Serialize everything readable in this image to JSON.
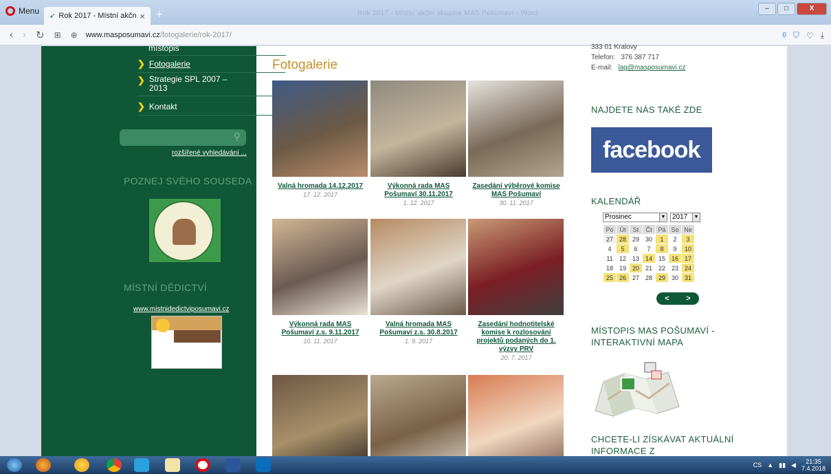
{
  "browser": {
    "menu_label": "Menu",
    "tab_title": "Rok 2017 - Místní akční sk",
    "tab_close": "×",
    "new_tab": "+",
    "window_title": "Rok 2017 - Místní akční skupina MAS Pošumaví - Word",
    "url_host": "www.masposumavi.cz",
    "url_path": "/fotogalerie/rok-2017/",
    "addr_right_count": "0"
  },
  "sidebar": {
    "top_item": "místopis",
    "items": [
      {
        "label": "Fotogalerie",
        "active": true
      },
      {
        "label": "Strategie SPL 2007 – 2013",
        "active": false
      },
      {
        "label": "Kontakt",
        "active": false
      }
    ],
    "advanced_search": "rozšířené vyhledávání ...",
    "neighbor_heading": "POZNEJ SVÉHO SOUSEDA",
    "heritage_heading": "MÍSTNÍ DĚDICTVÍ",
    "heritage_link": "www.mistnidedictviposumavi.cz"
  },
  "main": {
    "title": "Fotogalerie",
    "gallery": [
      {
        "title": "Valná hromada 14.12.2017",
        "date": "17. 12. 2017",
        "colors": [
          "#3e5a86",
          "#6d5a45",
          "#b98d6e"
        ]
      },
      {
        "title": "Výkonná rada MAS Pošumaví 30.11.2017",
        "date": "1. 12. 2017",
        "colors": [
          "#8f8a7e",
          "#c4b49b",
          "#4b3b2e"
        ]
      },
      {
        "title": "Zasedání výběrové komise MAS Pošumaví",
        "date": "30. 11. 2017",
        "colors": [
          "#e4e3df",
          "#7a6a57",
          "#b2a48e"
        ]
      },
      {
        "title": "Výkonná rada MAS Pošumaví z.s. 9.11.2017",
        "date": "10. 11. 2017",
        "colors": [
          "#d2b694",
          "#6d5b52",
          "#e9e2d6"
        ]
      },
      {
        "title": "Valná hromada MAS Pošumaví z.s. 30.8.2017",
        "date": "1. 9. 2017",
        "colors": [
          "#b68a63",
          "#e0d6c6",
          "#6b5b4b"
        ]
      },
      {
        "title": "Zasedání hodnotitelské komise k rozlosování projektů podaných do 1. výzvy PRV",
        "date": "20. 7. 2017",
        "colors": [
          "#c89a76",
          "#7b1e24",
          "#3f3f3f"
        ]
      },
      {
        "title": "",
        "date": "",
        "colors": [
          "#6e5845",
          "#a88f6a",
          "#2f261f"
        ]
      },
      {
        "title": "",
        "date": "",
        "colors": [
          "#b9a88f",
          "#7a6148",
          "#d8cfc2"
        ]
      },
      {
        "title": "",
        "date": "",
        "colors": [
          "#d97b52",
          "#f0d7c0",
          "#7a5a4a"
        ]
      }
    ]
  },
  "right": {
    "address_line": "333 01 Kralovy",
    "phone_label": "Telefon:",
    "phone": "376 387 717",
    "email_label": "E-mail:",
    "email": "lag@masposumavi.cz",
    "find_us_heading": "NAJDETE NÁS TAKÉ ZDE",
    "facebook_text": "facebook",
    "facebook_dot": ".",
    "calendar_heading": "KALENDÁŘ",
    "calendar": {
      "month": "Prosinec",
      "year": "2017",
      "weekdays": [
        "Po",
        "Út",
        "St",
        "Čt",
        "Pá",
        "So",
        "Ne"
      ],
      "weeks": [
        [
          [
            "27",
            "hl-no"
          ],
          [
            "28",
            "hl"
          ],
          [
            "29",
            "no"
          ],
          [
            "30",
            "no"
          ],
          [
            "1",
            "hl"
          ],
          [
            "2",
            "no"
          ],
          [
            "3",
            "hl"
          ]
        ],
        [
          [
            "4",
            "no"
          ],
          [
            "5",
            "hl"
          ],
          [
            "6",
            "no"
          ],
          [
            "7",
            "no"
          ],
          [
            "8",
            "hl"
          ],
          [
            "9",
            "no"
          ],
          [
            "10",
            "hl"
          ]
        ],
        [
          [
            "11",
            "no"
          ],
          [
            "12",
            "no"
          ],
          [
            "13",
            "no"
          ],
          [
            "14",
            "hl"
          ],
          [
            "15",
            "no"
          ],
          [
            "16",
            "hl"
          ],
          [
            "17",
            "hl"
          ]
        ],
        [
          [
            "18",
            "no"
          ],
          [
            "19",
            "no"
          ],
          [
            "20",
            "hl"
          ],
          [
            "21",
            "no"
          ],
          [
            "22",
            "no"
          ],
          [
            "23",
            "no"
          ],
          [
            "24",
            "hl"
          ]
        ],
        [
          [
            "25",
            "hl"
          ],
          [
            "26",
            "hl"
          ],
          [
            "27",
            "no"
          ],
          [
            "28",
            "no"
          ],
          [
            "29",
            "hl"
          ],
          [
            "30",
            "no"
          ],
          [
            "31",
            "hl"
          ]
        ]
      ],
      "prev": "<",
      "next": ">"
    },
    "mistopis_heading": "MÍSTOPIS MAS POŠUMAVÍ - INTERAKTIVNÍ MAPA",
    "subscribe_heading": "CHCETE-LI ZÍSKÁVAT AKTUÁLNÍ INFORMACE Z"
  },
  "taskbar": {
    "lang": "CS",
    "time": "21:35",
    "date": "7.4.2018"
  }
}
